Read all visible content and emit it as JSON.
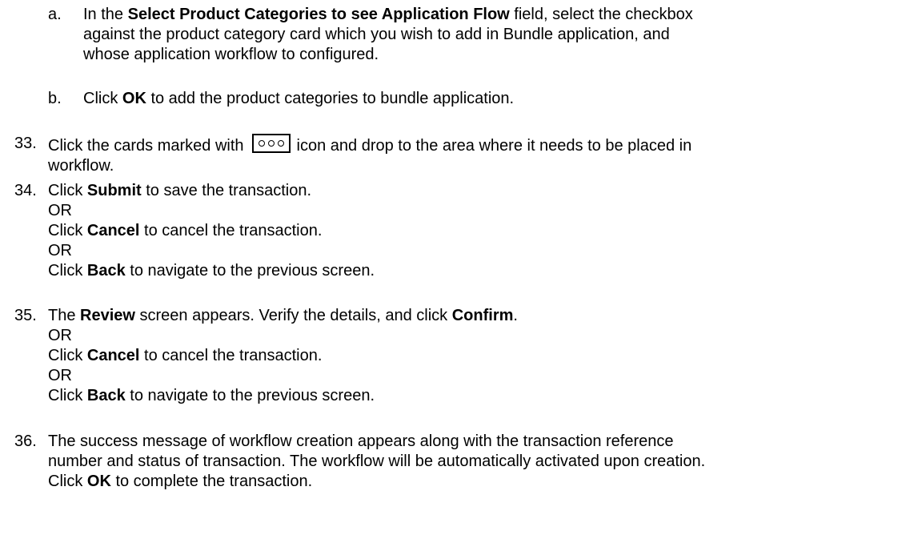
{
  "substeps": [
    {
      "letter": "a.",
      "line1_pre": "In the ",
      "line1_bold": "Select Product Categories to see Application Flow",
      "line1_post": " field, select the checkbox",
      "line2": "against the product category card which you wish to add in Bundle application, and",
      "line3": "whose application workflow to configured."
    },
    {
      "letter": "b.",
      "pre": "Click ",
      "bold": "OK",
      "post": " to add the product categories to bundle application."
    }
  ],
  "step33": {
    "number": "33.",
    "pre": "Click the cards marked with",
    "icon": "three-dots-icon",
    "post": "icon and drop to the area where it needs to be placed in",
    "line2": "workflow."
  },
  "step34": {
    "number": "34.",
    "l1_pre": "Click ",
    "l1_bold": "Submit",
    "l1_post": " to save the transaction.",
    "or1": "OR",
    "l2_pre": "Click ",
    "l2_bold": "Cancel",
    "l2_post": " to cancel the transaction.",
    "or2": "OR",
    "l3_pre": "Click ",
    "l3_bold": "Back",
    "l3_post": " to navigate to the previous screen."
  },
  "step35": {
    "number": "35.",
    "l1_pre": "The ",
    "l1_bold": "Review",
    "l1_mid": " screen appears. Verify the details, and click ",
    "l1_bold2": "Confirm",
    "l1_post": ".",
    "or1": "OR",
    "l2_pre": "Click ",
    "l2_bold": "Cancel",
    "l2_post": " to cancel the transaction.",
    "or2": "OR",
    "l3_pre": "Click ",
    "l3_bold": "Back",
    "l3_post": " to navigate to the previous screen."
  },
  "step36": {
    "number": "36.",
    "line1": "The success message of workflow creation appears along with the transaction reference",
    "line2": "number and status of transaction. The workflow will be automatically activated upon creation.",
    "line3_pre": "Click ",
    "line3_bold": "OK",
    "line3_post": " to complete the transaction."
  }
}
